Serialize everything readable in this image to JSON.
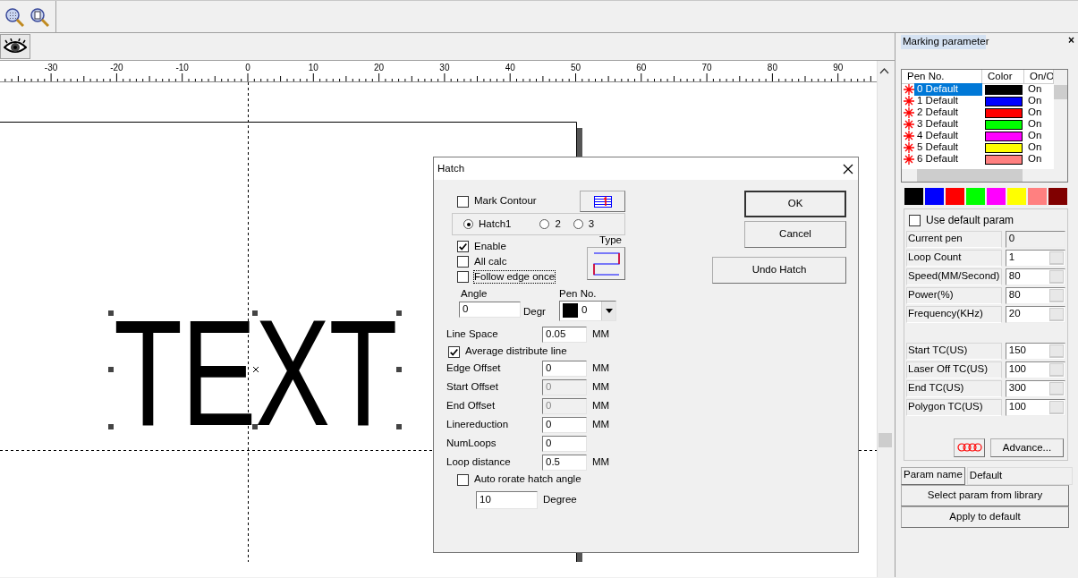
{
  "ruler": {
    "labels": [
      "-30",
      "-20",
      "-10",
      "0",
      "10",
      "20",
      "30",
      "40",
      "50",
      "60",
      "70",
      "80",
      "90"
    ]
  },
  "canvas": {
    "object_text": "TEXT"
  },
  "hatch_dialog": {
    "title": "Hatch",
    "mark_contour": {
      "label": "Mark Contour",
      "checked": false
    },
    "hatch_options": [
      {
        "label": "Hatch1",
        "selected": true
      },
      {
        "label": "2",
        "selected": false
      },
      {
        "label": "3",
        "selected": false
      }
    ],
    "options": [
      {
        "label": "Enable",
        "checked": true,
        "focused": false
      },
      {
        "label": "All calc",
        "checked": false,
        "focused": false
      },
      {
        "label": "Follow edge once",
        "checked": false,
        "focused": true
      }
    ],
    "type_label": "Type",
    "angle": {
      "label": "Angle",
      "value": "0",
      "unit": "Degr"
    },
    "pen": {
      "label": "Pen No.",
      "value": "0",
      "color": "#000000"
    },
    "fields": [
      {
        "kind": "field",
        "label": "Line Space",
        "value": "0.05",
        "unit": "MM",
        "disabled": false
      },
      {
        "kind": "checkbox",
        "label": "Average distribute line",
        "checked": true
      },
      {
        "kind": "field",
        "label": "Edge Offset",
        "value": "0",
        "unit": "MM",
        "disabled": false
      },
      {
        "kind": "field",
        "label": "Start Offset",
        "value": "0",
        "unit": "MM",
        "disabled": true
      },
      {
        "kind": "field",
        "label": "End Offset",
        "value": "0",
        "unit": "MM",
        "disabled": true
      },
      {
        "kind": "field",
        "label": "Linereduction",
        "value": "0",
        "unit": "MM",
        "disabled": false
      },
      {
        "kind": "field",
        "label": "NumLoops",
        "value": "0",
        "disabled": false
      },
      {
        "kind": "field",
        "label": "Loop distance",
        "value": "0.5",
        "unit": "MM",
        "disabled": false
      }
    ],
    "auto_rotate": {
      "label": "Auto rorate hatch angle",
      "checked": false
    },
    "rotate_step": {
      "value": "10",
      "unit": "Degree"
    },
    "buttons": [
      {
        "label": "OK",
        "kind": "default"
      },
      {
        "label": "Cancel",
        "kind": "normal"
      },
      {
        "label": "Undo Hatch",
        "kind": "wide"
      }
    ]
  },
  "marking_panel": {
    "title": "Marking parameter",
    "close": "×",
    "pen_table": {
      "columns": [
        "Pen No.",
        "Color",
        "On/O"
      ],
      "rows": [
        {
          "pen": "0 Default",
          "color": "#000000",
          "state": "On",
          "selected": true
        },
        {
          "pen": "1 Default",
          "color": "#0000ff",
          "state": "On",
          "selected": false
        },
        {
          "pen": "2 Default",
          "color": "#ff0000",
          "state": "On",
          "selected": false
        },
        {
          "pen": "3 Default",
          "color": "#00ff00",
          "state": "On",
          "selected": false
        },
        {
          "pen": "4 Default",
          "color": "#ff00ff",
          "state": "On",
          "selected": false
        },
        {
          "pen": "5 Default",
          "color": "#ffff00",
          "state": "On",
          "selected": false
        },
        {
          "pen": "6 Default",
          "color": "#ff8080",
          "state": "On",
          "selected": false
        }
      ]
    },
    "palette": [
      {
        "color": "#000000"
      },
      {
        "color": "#0000ff"
      },
      {
        "color": "#ff0000"
      },
      {
        "color": "#00ff00"
      },
      {
        "color": "#ff00ff"
      },
      {
        "color": "#ffff00"
      },
      {
        "color": "#ff8080"
      },
      {
        "color": "#800000"
      }
    ],
    "use_default": {
      "label": "Use default param",
      "checked": false
    },
    "params": [
      {
        "label": "Current pen",
        "value": "0",
        "readonly": true
      },
      {
        "label": "Loop Count",
        "value": "1",
        "readonly": false
      },
      {
        "label": "Speed(MM/Second)",
        "value": "80",
        "readonly": false
      },
      {
        "label": "Power(%)",
        "value": "80",
        "readonly": false
      },
      {
        "label": "Frequency(KHz)",
        "value": "20",
        "readonly": false
      }
    ],
    "timing_params": [
      {
        "label": "Start TC(US)",
        "value": "150",
        "readonly": false
      },
      {
        "label": "Laser Off TC(US)",
        "value": "100",
        "readonly": false
      },
      {
        "label": "End TC(US)",
        "value": "300",
        "readonly": false
      },
      {
        "label": "Polygon TC(US)",
        "value": "100",
        "readonly": false
      }
    ],
    "advance_button": "Advance...",
    "param_name": {
      "label": "Param name",
      "value": "Default"
    },
    "buttons": [
      "Select param from library",
      "Apply to default"
    ]
  }
}
